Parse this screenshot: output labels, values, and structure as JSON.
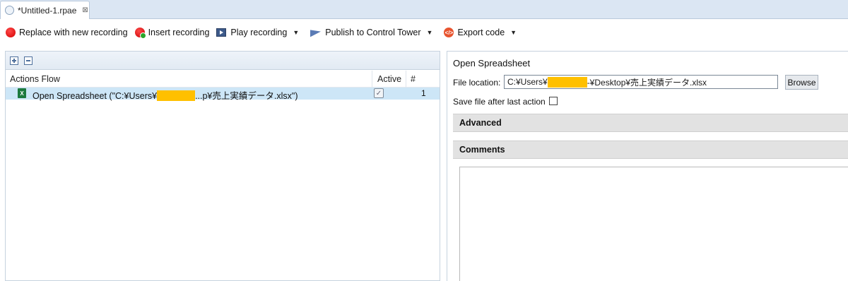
{
  "tab": {
    "label": "*Untitled-1.rpae",
    "close": "⊠"
  },
  "toolbar": {
    "replace_label": "Replace with new recording",
    "insert_label": "Insert recording",
    "play_label": "Play recording",
    "publish_label": "Publish to Control Tower",
    "export_label": "Export code",
    "dropdown_glyph": "▼"
  },
  "actions_flow": {
    "columns": {
      "flow": "Actions Flow",
      "active": "Active",
      "num": "#"
    },
    "rows": [
      {
        "icon": "X",
        "text_before": "Open Spreadsheet (\"C:¥Users¥",
        "text_after": "...p¥売上実績データ.xlsx\")",
        "active_check": "✓",
        "num": "1"
      }
    ]
  },
  "properties": {
    "title": "Open Spreadsheet",
    "file_location_label": "File location:",
    "file_location_before": "C:¥Users¥",
    "file_location_after": "-¥Desktop¥売上実績データ.xlsx",
    "browse_label": "Browse",
    "save_label": "Save file after last action",
    "advanced_label": "Advanced",
    "comments_label": "Comments"
  },
  "colors": {
    "redaction": "#ffc000",
    "selection": "#cde6f7"
  }
}
